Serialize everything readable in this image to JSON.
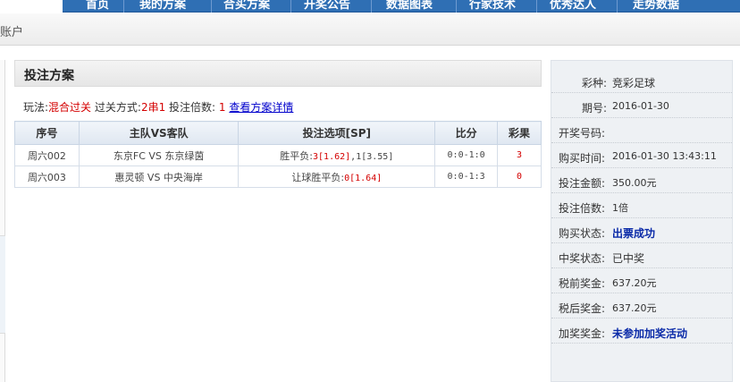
{
  "nav": {
    "items": [
      "首页",
      "我的方案",
      "合买方案",
      "开奖公告",
      "数据图表",
      "行家技术",
      "优秀达人",
      "走势数据"
    ]
  },
  "breadcrumb": {
    "text": "账户"
  },
  "panel": {
    "title": "投注方案",
    "play_label": "玩法:",
    "play_value": "混合过关",
    "pass_label": "过关方式:",
    "pass_value": "2串1",
    "multi_label": "投注倍数:",
    "multi_value": "1",
    "detail_link": "查看方案详情"
  },
  "table": {
    "headers": [
      "序号",
      "主队VS客队",
      "投注选项[SP]",
      "比分",
      "彩果"
    ],
    "rows": [
      {
        "id": "周六002",
        "teams": "东京FC VS 东京绿茵",
        "opt_prefix": "胜平负:",
        "opt_red": "3[1.62]",
        "opt_rest": ",1[3.55]",
        "score": "0:0-1:0",
        "result": "3"
      },
      {
        "id": "周六003",
        "teams": "惠灵顿 VS 中央海岸",
        "opt_prefix": "让球胜平负:",
        "opt_red": "0[1.64]",
        "opt_rest": "",
        "score": "0:0-1:3",
        "result": "0"
      }
    ]
  },
  "info": {
    "lottery_label": "彩种:",
    "lottery_value": "竞彩足球",
    "issue_label": "期号:",
    "issue_value": "2016-01-30",
    "draw_label": "开奖号码:",
    "draw_value": "",
    "buy_time_label": "购买时间:",
    "buy_time_value": "2016-01-30 13:43:11",
    "amount_label": "投注金额:",
    "amount_value": "350.00元",
    "multi_label": "投注倍数:",
    "multi_value": "1倍",
    "buy_status_label": "购买状态:",
    "buy_status_value": "出票成功",
    "win_status_label": "中奖状态:",
    "win_status_value": "已中奖",
    "pre_tax_label": "税前奖金:",
    "pre_tax_value": "637.20",
    "pre_tax_unit": "元",
    "after_tax_label": "税后奖金:",
    "after_tax_value": "637.20",
    "after_tax_unit": "元",
    "bonus_label": "加奖奖金:",
    "bonus_value": "未参加加奖活动"
  },
  "colors": {
    "nav_blue": "#2f6fb4",
    "red": "#d40000",
    "link_blue": "#0000cc",
    "status_blue": "#0a2aa8"
  }
}
